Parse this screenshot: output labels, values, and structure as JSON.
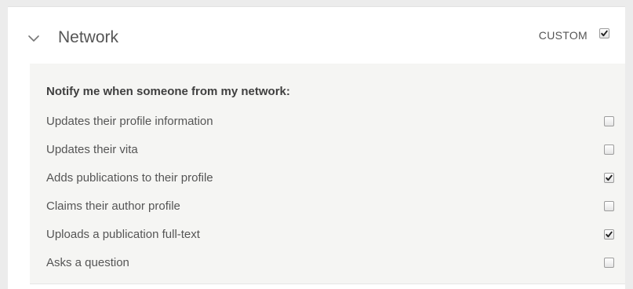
{
  "section": {
    "title": "Network",
    "expand_icon": "chevron-down-icon",
    "custom": {
      "label": "CUSTOM",
      "checked": true
    }
  },
  "panel": {
    "heading": "Notify me when someone from my network:",
    "options": [
      {
        "label": "Updates their profile information",
        "checked": false
      },
      {
        "label": "Updates their vita",
        "checked": false
      },
      {
        "label": "Adds publications to their profile",
        "checked": true
      },
      {
        "label": "Claims their author profile",
        "checked": false
      },
      {
        "label": "Uploads a publication full-text",
        "checked": true
      },
      {
        "label": "Asks a question",
        "checked": false
      }
    ]
  },
  "colors": {
    "panel_background": "#f5f5f3",
    "text": "#555555",
    "heading_text": "#3f3f3f"
  }
}
